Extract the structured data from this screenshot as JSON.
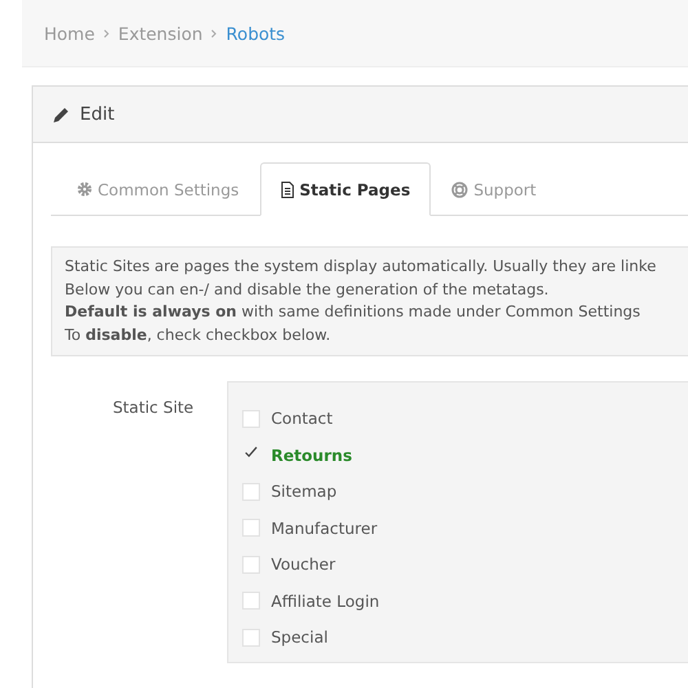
{
  "breadcrumb": [
    {
      "label": "Home",
      "selected": false
    },
    {
      "label": "Extension",
      "selected": false
    },
    {
      "label": "Robots",
      "selected": true
    }
  ],
  "panel": {
    "title": "Edit"
  },
  "tabs": [
    {
      "label": "Common Settings",
      "kind": "gear",
      "selected": false
    },
    {
      "label": "Static Pages",
      "kind": "document",
      "selected": true
    },
    {
      "label": "Support",
      "kind": "lifebuoy",
      "selected": false
    }
  ],
  "info_lines": [
    "Static Sites are pages the system display automatically. Usually they are linke",
    "Below you can en-/ and disable the generation of the metatags.",
    "**Default is always on** with same definitions made under Common Settings",
    "To **disable**, check checkbox below."
  ],
  "field": {
    "label": "Static Site",
    "options": [
      {
        "label": "Contact",
        "checked": false
      },
      {
        "label": "Retourns",
        "checked": true
      },
      {
        "label": "Sitemap",
        "checked": false
      },
      {
        "label": "Manufacturer",
        "checked": false
      },
      {
        "label": "Voucher",
        "checked": false
      },
      {
        "label": "Affiliate Login",
        "checked": false
      },
      {
        "label": "Special",
        "checked": false
      }
    ]
  }
}
